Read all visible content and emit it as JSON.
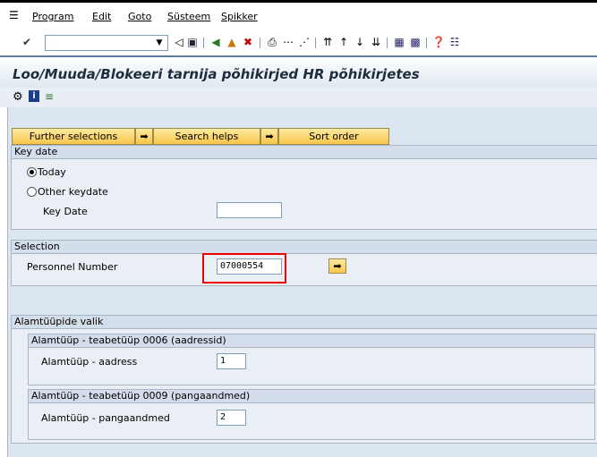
{
  "menu": {
    "items": [
      "Program",
      "Edit",
      "Goto",
      "Süsteem",
      "Spikker"
    ]
  },
  "toolbar": {
    "command_value": ""
  },
  "title": "Loo/Muuda/Blokeeri tarnija põhikirjed HR põhikirjetes",
  "buttons": {
    "further_selections": "Further selections",
    "search_helps": "Search helps",
    "sort_order": "Sort order"
  },
  "key_date_group": {
    "header": "Key date",
    "today": "Today",
    "other_keydate": "Other keydate",
    "key_date_label": "Key Date",
    "key_date_value": "",
    "selected": "Today"
  },
  "selection_group": {
    "header": "Selection",
    "personnel_label": "Personnel Number",
    "personnel_value": "07000554"
  },
  "subtype_group": {
    "header": "Alamtüüpide valik",
    "sub1": {
      "header": "Alamtüüp - teabetüüp 0006 (aadressid)",
      "label": "Alamtüüp - aadress",
      "value": "1"
    },
    "sub2": {
      "header": "Alamtüüp - teabetüüp 0009 (pangaandmed)",
      "label": "Alamtüüp - pangaandmed",
      "value": "2"
    }
  },
  "colors": {
    "title": "#1e2d3d",
    "highlight": "#ee0000",
    "button": "#f7c64a"
  }
}
